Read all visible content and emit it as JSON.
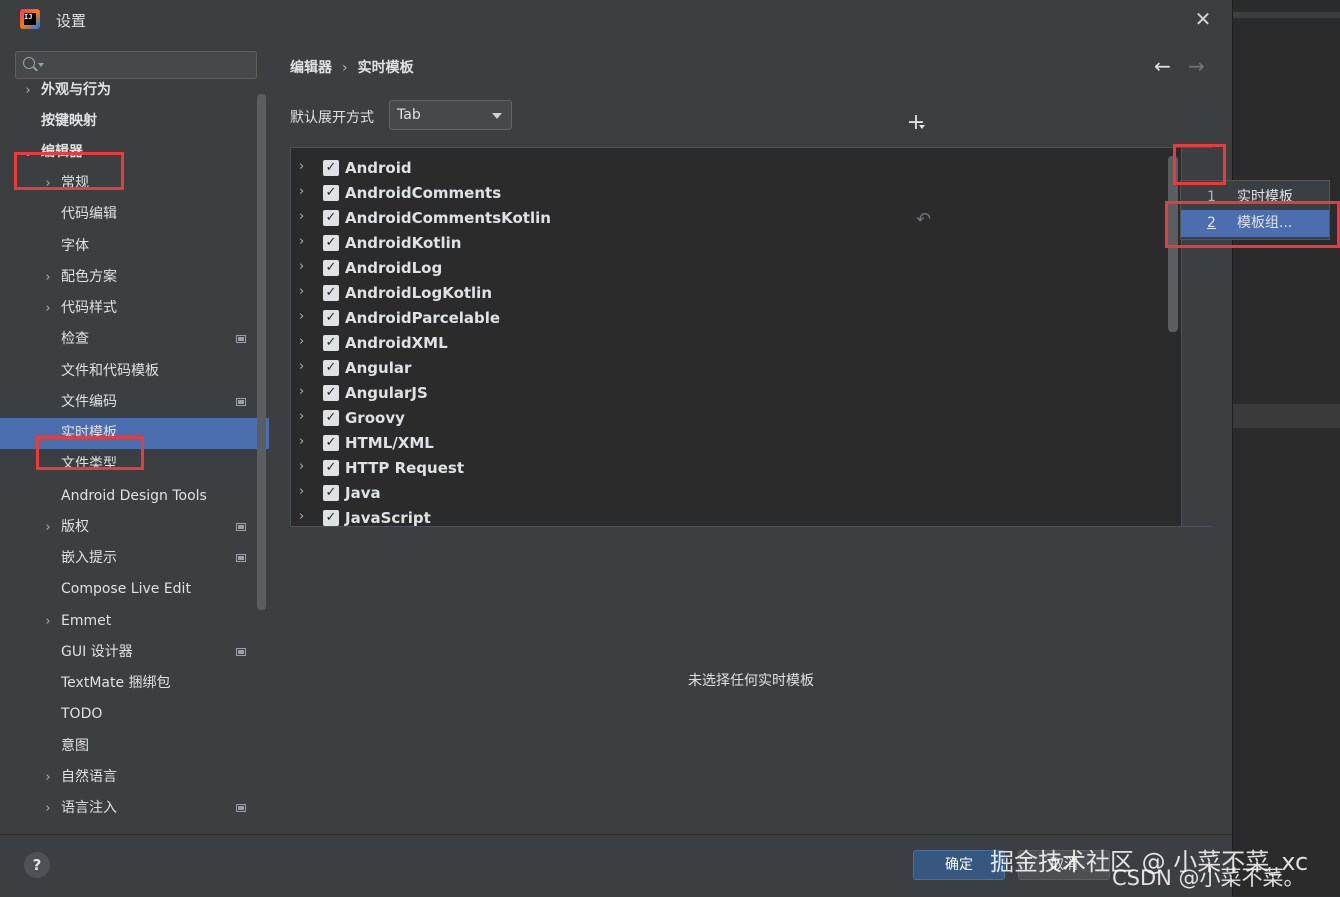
{
  "window": {
    "title": "设置"
  },
  "sidebar": {
    "items": [
      {
        "label": "外观与行为",
        "chevron": "›"
      },
      {
        "label": "按键映射"
      },
      {
        "label": "编辑器",
        "chevron": "⌄"
      },
      {
        "label": "常规",
        "chevron": "›"
      },
      {
        "label": "代码编辑"
      },
      {
        "label": "字体"
      },
      {
        "label": "配色方案",
        "chevron": "›"
      },
      {
        "label": "代码样式",
        "chevron": "›"
      },
      {
        "label": "检查"
      },
      {
        "label": "文件和代码模板"
      },
      {
        "label": "文件编码"
      },
      {
        "label": "实时模板"
      },
      {
        "label": "文件类型"
      },
      {
        "label": "Android Design Tools"
      },
      {
        "label": "版权",
        "chevron": "›"
      },
      {
        "label": "嵌入提示"
      },
      {
        "label": "Compose Live Edit"
      },
      {
        "label": "Emmet",
        "chevron": "›"
      },
      {
        "label": "GUI 设计器"
      },
      {
        "label": "TextMate 捆绑包"
      },
      {
        "label": "TODO"
      },
      {
        "label": "意图"
      },
      {
        "label": "自然语言",
        "chevron": "›"
      },
      {
        "label": "语言注入",
        "chevron": "›"
      }
    ]
  },
  "content": {
    "breadcrumb": [
      "编辑器",
      "实时模板"
    ],
    "breadcrumb_sep": "›",
    "nav": {
      "back": "←",
      "forward": "→"
    },
    "expand_label": "默认展开方式",
    "expand_value": "Tab",
    "templates": [
      "Android",
      "AndroidComments",
      "AndroidCommentsKotlin",
      "AndroidKotlin",
      "AndroidLog",
      "AndroidLogKotlin",
      "AndroidParcelable",
      "AndroidXML",
      "Angular",
      "AngularJS",
      "Groovy",
      "HTML/XML",
      "HTTP Request",
      "Java",
      "JavaScript"
    ],
    "row_chevron": "›",
    "check_mark": "✓",
    "add_symbol": "+",
    "undo_symbol": "↶",
    "empty_message": "未选择任何实时模板"
  },
  "popup": {
    "items": [
      {
        "num": "1",
        "label": "实时模板"
      },
      {
        "num": "2",
        "label": "模板组..."
      }
    ]
  },
  "footer": {
    "help": "?",
    "ok": "确定",
    "cancel": "取消"
  },
  "watermarks": {
    "juejin": "掘金技术社区 @ 小菜不菜_xc",
    "csdn": "CSDN @小菜不菜。"
  },
  "colors": {
    "accent": "#4b6eaf",
    "highlight": "#e83c3c",
    "ok_button": "#365880"
  }
}
